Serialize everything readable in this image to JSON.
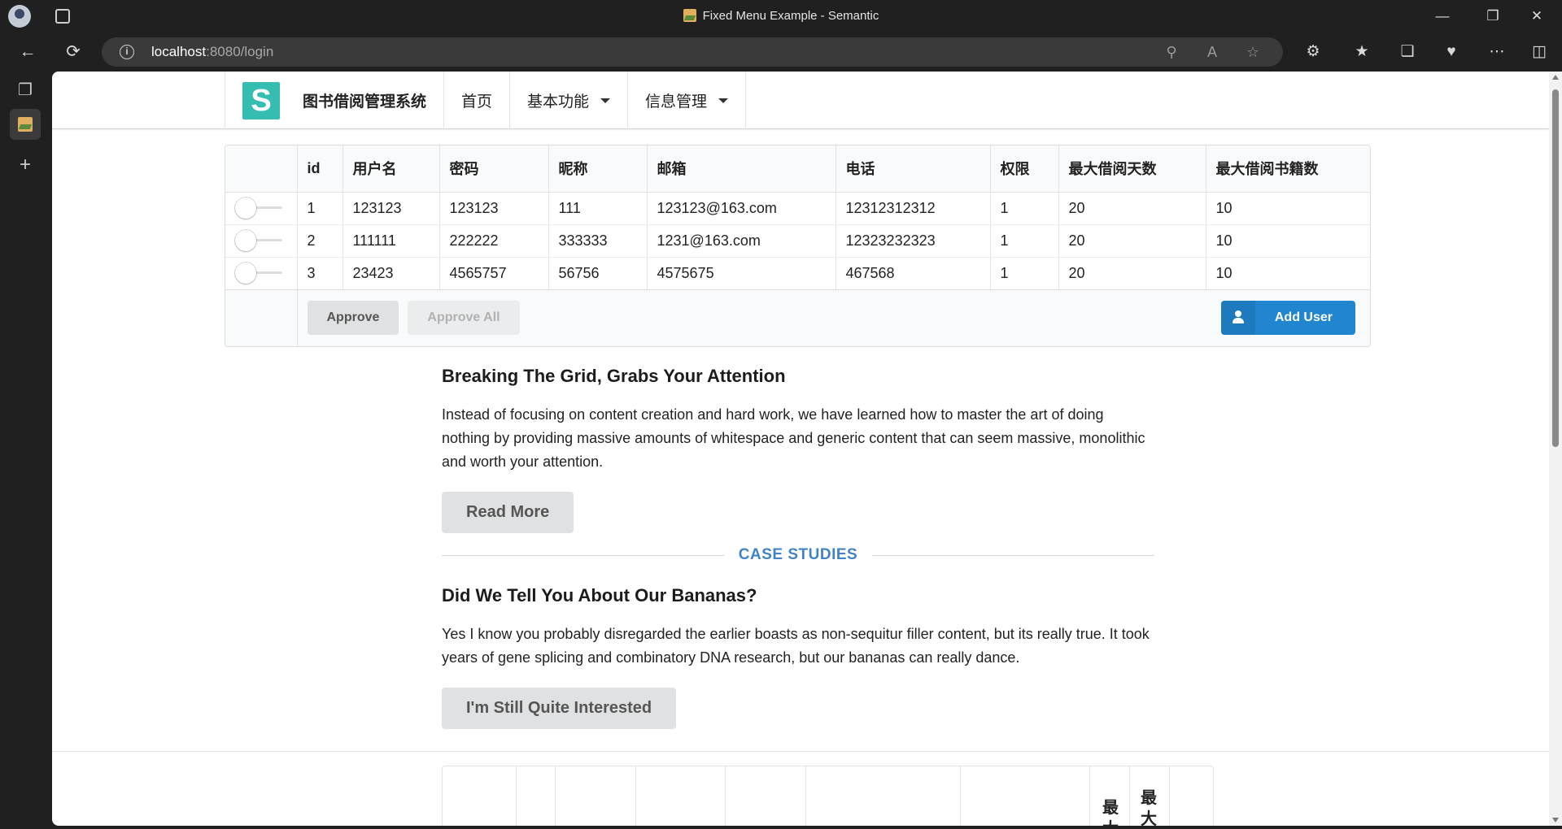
{
  "browser": {
    "window_title": "Fixed Menu Example - Semantic",
    "url_host": "localhost",
    "url_rest": ":8080/login"
  },
  "nav": {
    "brand_letter": "S",
    "brand_text": "图书借阅管理系统",
    "home": "首页",
    "basic": "基本功能",
    "info": "信息管理"
  },
  "table": {
    "headers": [
      "id",
      "用户名",
      "密码",
      "昵称",
      "邮箱",
      "电话",
      "权限",
      "最大借阅天数",
      "最大借阅书籍数"
    ],
    "rows": [
      [
        "1",
        "123123",
        "123123",
        "111",
        "123123@163.com",
        "12312312312",
        "1",
        "20",
        "10"
      ],
      [
        "2",
        "111111",
        "222222",
        "333333",
        "1231@163.com",
        "12323232323",
        "1",
        "20",
        "10"
      ],
      [
        "3",
        "23423",
        "4565757",
        "56756",
        "4575675",
        "467568",
        "1",
        "20",
        "10"
      ]
    ],
    "approve": "Approve",
    "approve_all": "Approve All",
    "add_user": "Add User"
  },
  "content": {
    "h1": "Breaking The Grid, Grabs Your Attention",
    "p1": "Instead of focusing on content creation and hard work, we have learned how to master the art of doing nothing by providing massive amounts of whitespace and generic content that can seem massive, monolithic and worth your attention.",
    "btn1": "Read More",
    "divider": "CASE STUDIES",
    "h2": "Did We Tell You About Our Bananas?",
    "p2": "Yes I know you probably disregarded the earlier boasts as non-sequitur filler content, but its really true. It took years of gene splicing and combinatory DNA research, but our bananas can really dance.",
    "btn2": "I'm Still Quite Interested"
  },
  "bottom_table": {
    "partial_chars": [
      "最",
      "大",
      "最",
      "大"
    ]
  },
  "colors": {
    "brand": "#35bdb2",
    "primary": "#2185d0",
    "link": "#4183c4"
  }
}
